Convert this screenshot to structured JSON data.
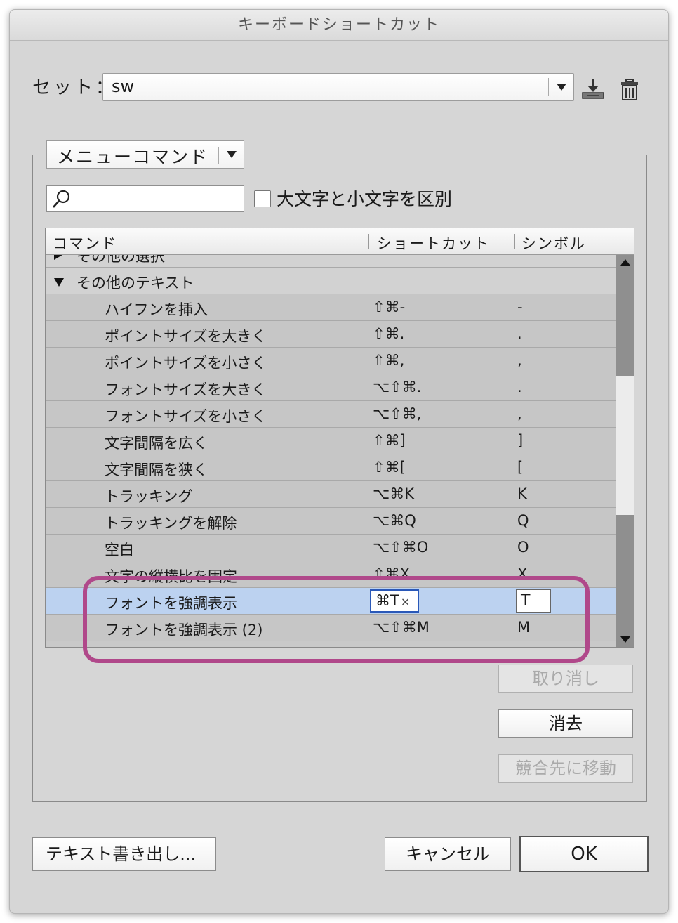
{
  "window": {
    "title": "キーボードショートカット"
  },
  "set": {
    "label": "セット：",
    "value": "sw"
  },
  "toolbar": {
    "save_icon": "save-set-icon",
    "delete_icon": "trash-icon"
  },
  "filter": {
    "area": "メニューコマンド",
    "search_value": "",
    "case_label": "大文字と小文字を区別",
    "case_checked": false
  },
  "table": {
    "headers": {
      "command": "コマンド",
      "shortcut": "ショートカット",
      "symbol": "シンボル"
    },
    "rows": [
      {
        "type": "category",
        "expanded": false,
        "command": "その他の選択",
        "shortcut": "",
        "symbol": ""
      },
      {
        "type": "category",
        "expanded": true,
        "command": "その他のテキスト",
        "shortcut": "",
        "symbol": ""
      },
      {
        "type": "command",
        "command": "ハイフンを挿入",
        "shortcut": "⇧⌘-",
        "symbol": "-"
      },
      {
        "type": "command",
        "command": "ポイントサイズを大きく",
        "shortcut": "⇧⌘.",
        "symbol": "."
      },
      {
        "type": "command",
        "command": "ポイントサイズを小さく",
        "shortcut": "⇧⌘,",
        "symbol": ","
      },
      {
        "type": "command",
        "command": "フォントサイズを大きく",
        "shortcut": "⌥⇧⌘.",
        "symbol": "."
      },
      {
        "type": "command",
        "command": "フォントサイズを小さく",
        "shortcut": "⌥⇧⌘,",
        "symbol": ","
      },
      {
        "type": "command",
        "command": "文字間隔を広く",
        "shortcut": "⇧⌘]",
        "symbol": "]"
      },
      {
        "type": "command",
        "command": "文字間隔を狭く",
        "shortcut": "⇧⌘[",
        "symbol": "["
      },
      {
        "type": "command",
        "command": "トラッキング",
        "shortcut": "⌥⌘K",
        "symbol": "K"
      },
      {
        "type": "command",
        "command": "トラッキングを解除",
        "shortcut": "⌥⌘Q",
        "symbol": "Q"
      },
      {
        "type": "command",
        "command": "空白",
        "shortcut": "⌥⇧⌘O",
        "symbol": "O"
      },
      {
        "type": "command",
        "command": "文字の縦横比を固定",
        "shortcut": "⇧⌘X",
        "symbol": "X"
      },
      {
        "type": "selected",
        "command": "フォントを強調表示",
        "shortcut": "⌘T",
        "symbol": "T"
      },
      {
        "type": "command",
        "command": "フォントを強調表示 (2)",
        "shortcut": "⌥⇧⌘M",
        "symbol": "M"
      }
    ],
    "edit_clear_glyph": "×"
  },
  "side_buttons": {
    "undo": "取り消し",
    "clear": "消去",
    "goto_conflict": "競合先に移動"
  },
  "footer": {
    "export": "テキスト書き出し...",
    "cancel": "キャンセル",
    "ok": "OK"
  },
  "colors": {
    "selection": "#bcd2f0",
    "highlight": "#b0488a"
  }
}
